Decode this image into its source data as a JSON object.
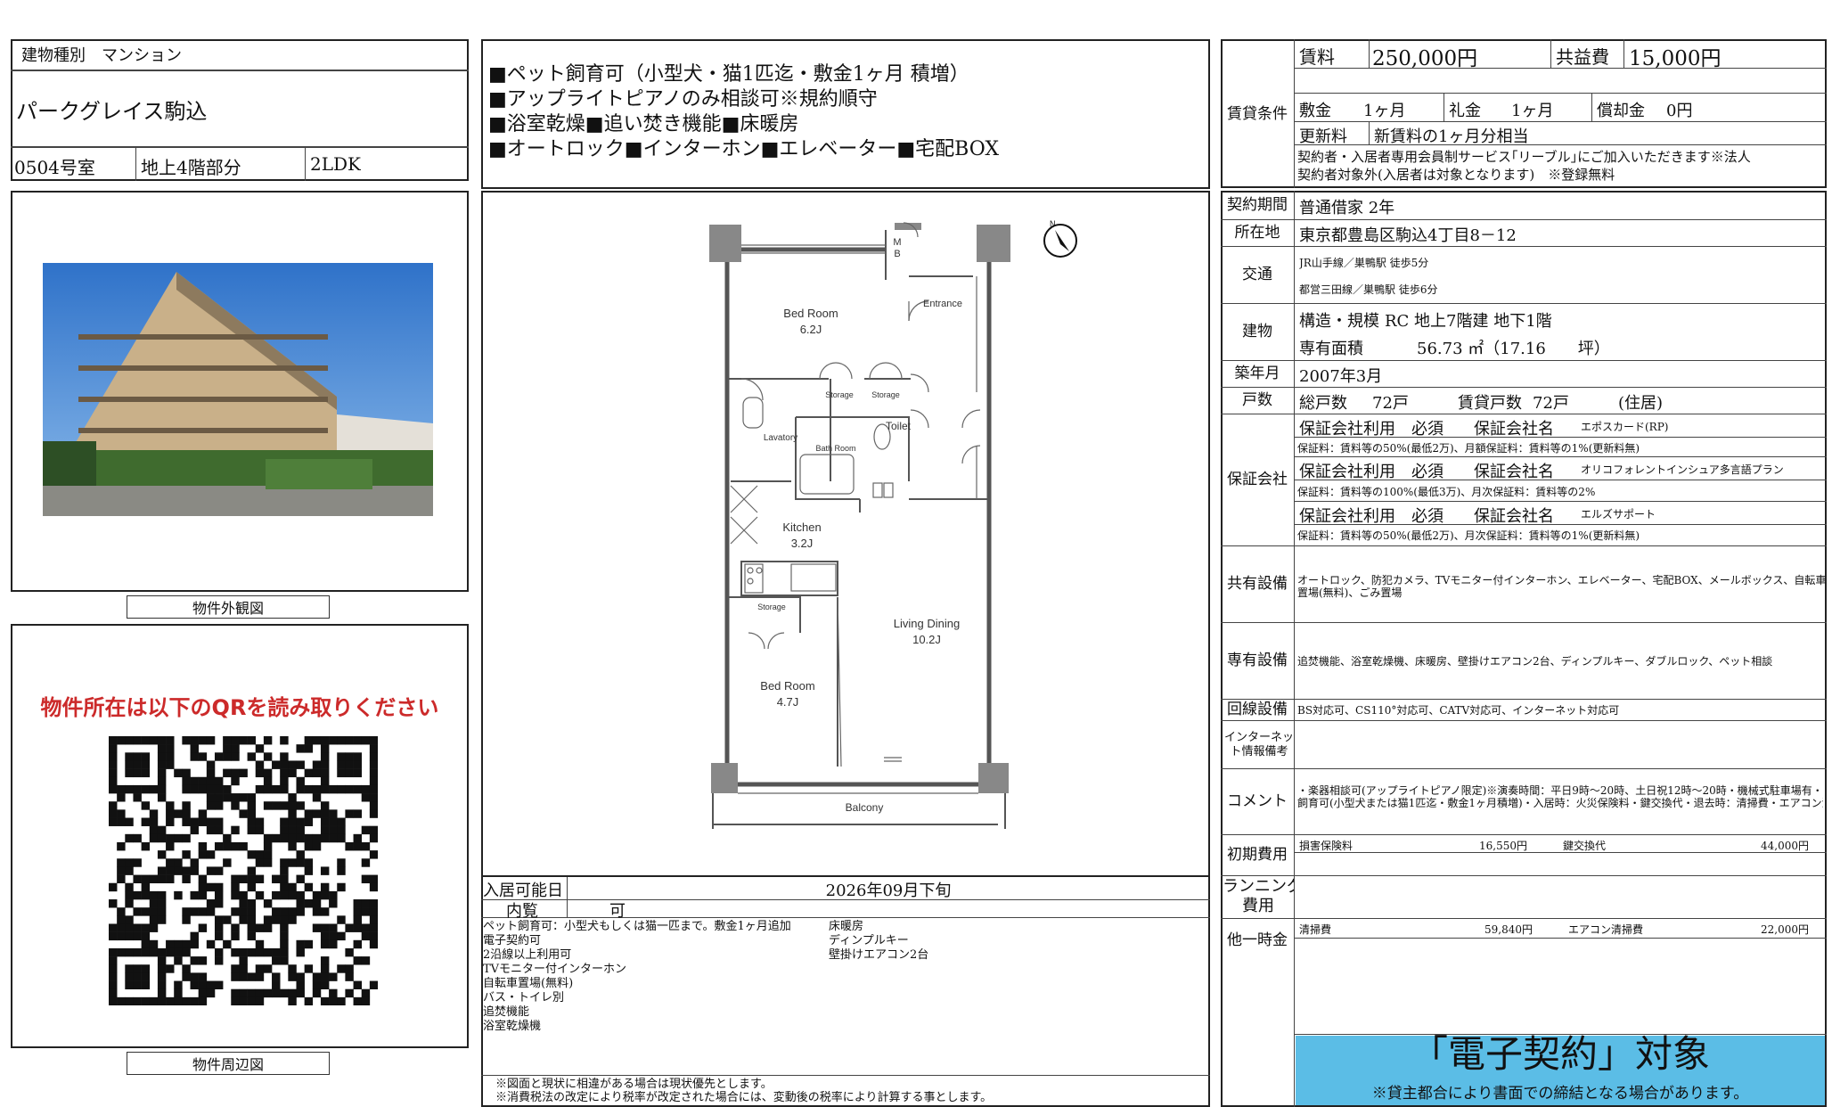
{
  "header": {
    "building_type_label": "建物種別",
    "building_type_value": "マンション",
    "property_name": "パークグレイス駒込",
    "room_no": "0504号室",
    "floor": "地上4階部分",
    "layout": "2LDK"
  },
  "features": [
    "■ペット飼育可（小型犬・猫1匹迄・敷金1ヶ月 積増）",
    "■アップライトピアノのみ相談可※規約順守",
    "■浴室乾燥■追い焚き機能■床暖房",
    "■オートロック■インターホン■エレベーター■宅配BOX"
  ],
  "captions": {
    "exterior": "物件外観図",
    "map": "物件周辺図"
  },
  "qr": {
    "heading": "物件所在は以下のQRを読み取りください"
  },
  "floorplan": {
    "bed1_name": "Bed Room",
    "bed1_size": "6.2J",
    "mb": "M",
    "mb2": "B",
    "entrance": "Entrance",
    "storage": "Storage",
    "storage2": "Storage",
    "storage3": "Storage",
    "toilet": "Toilet",
    "lavatory": "Lavatory",
    "bath": "Bath Room",
    "kitchen_name": "Kitchen",
    "kitchen_size": "3.2J",
    "ld_name": "Living Dining",
    "ld_size": "10.2J",
    "bed2_name": "Bed Room",
    "bed2_size": "4.7J",
    "balcony": "Balcony",
    "north": "N"
  },
  "movein": {
    "label": "入居可能日",
    "value": "2026年09月下旬",
    "view_label": "内覧",
    "view_value": "可"
  },
  "notes_left": [
    "ペット飼育可：小型犬もしくは猫一匹まで。敷金1ヶ月追加",
    "電子契約可",
    "2沿線以上利用可",
    "TVモニター付インターホン",
    "自転車置場(無料)",
    "バス・トイレ別",
    "追焚機能",
    "浴室乾燥機"
  ],
  "notes_right": [
    "床暖房",
    "ディンプルキー",
    "壁掛けエアコン2台"
  ],
  "disclaimer": [
    "※図面と現状に相違がある場合は現状優先とします。",
    "※消費税法の改定により税率が改定された場合には、変動後の税率により計算する事とします。"
  ],
  "rent": {
    "section_label": "賃貸条件",
    "rent_label": "賃料",
    "rent_value": "250,000円",
    "fee_label": "共益費",
    "fee_value": "15,000円",
    "deposit_label": "敷金",
    "deposit_value": "1ヶ月",
    "key_label": "礼金",
    "key_value": "1ヶ月",
    "amort_label": "償却金",
    "amort_value": "0円",
    "renew_label": "更新料",
    "renew_value": "新賃料の1ヶ月分相当",
    "note1": "契約者・入居者専用会員制サービス｢リーブル｣にご加入いただきます※法人",
    "note2": "契約者対象外(入居者は対象となります)　※登録無料"
  },
  "contract": {
    "label": "契約期間",
    "value": "普通借家 2年"
  },
  "address": {
    "label": "所在地",
    "value": "東京都豊島区駒込4丁目8－12"
  },
  "transport": {
    "label": "交通",
    "line1": "JR山手線／巣鴨駅 徒歩5分",
    "line2": "都営三田線／巣鴨駅 徒歩6分"
  },
  "building": {
    "label": "建物",
    "structure_label": "構造・規模",
    "structure_value": "RC 地上7階建 地下1階",
    "area_label": "専有面積",
    "area_value": "56.73 ㎡（17.16　　坪）"
  },
  "built": {
    "label": "築年月",
    "value": "2007年3月"
  },
  "units": {
    "label": "戸数",
    "total_label": "総戸数",
    "total_value": "72戸",
    "rent_label": "賃貸戸数",
    "rent_value": "72戸",
    "kind": "(住居)"
  },
  "guarantee": {
    "label": "保証会社",
    "use_label": "保証会社利用",
    "req": "必須",
    "name_label": "保証会社名",
    "c1": "エポスカード(RP)",
    "c1_fee": "保証料：賃料等の50%(最低2万)、月額保証料：賃料等の1%(更新料無)",
    "c2": "オリコフォレントインシュア多言語プラン",
    "c2_fee": "保証料：賃料等の100%(最低3万)、月次保証料：賃料等の2%",
    "c3": "エルズサポート",
    "c3_fee": "保証料：賃料等の50%(最低2万)、月次保証料：賃料等の1%(更新料無)"
  },
  "shared": {
    "label": "共有設備",
    "value1": "オートロック、防犯カメラ、TVモニター付インターホン、エレベーター、宅配BOX、メールボックス、自転車",
    "value2": "置場(無料)、ごみ置場"
  },
  "private": {
    "label": "専有設備",
    "value": "追焚機能、浴室乾燥機、床暖房、壁掛けエアコン2台、ディンプルキー、ダブルロック、ペット相談"
  },
  "line": {
    "label": "回線設備",
    "value": "BS対応可、CS110°対応可、CATV対応可、インターネット対応可"
  },
  "internet": {
    "label1": "インターネッ",
    "label2": "ト情報備考"
  },
  "comment": {
    "label": "コメント",
    "value1": "・楽器相談可(アップライトピアノ限定)※演奏時間：平日9時～20時、土日祝12時～20時・機械式駐車場有・ペット",
    "value2": "飼育可(小型犬または猫1匹迄・敷金1ヶ月積増)・入居時：火災保険料・鍵交換代・退去時：清掃費・エアコン清掃"
  },
  "initial": {
    "label": "初期費用",
    "i1": "損害保険料",
    "v1": "16,550円",
    "i2": "鍵交換代",
    "v2": "44,000円"
  },
  "running": {
    "label1": "ランニング",
    "label2": "費用"
  },
  "onetime": {
    "label": "他一時金",
    "i1": "清掃費",
    "v1": "59,840円",
    "i2": "エアコン清掃費",
    "v2": "22,000円"
  },
  "econtract": {
    "title": "「電子契約」対象",
    "note": "※貸主都合により書面での締結となる場合があります。"
  },
  "colors": {
    "econtract_bg": "#5bbde6",
    "qr_heading": "#cc2a2a"
  }
}
